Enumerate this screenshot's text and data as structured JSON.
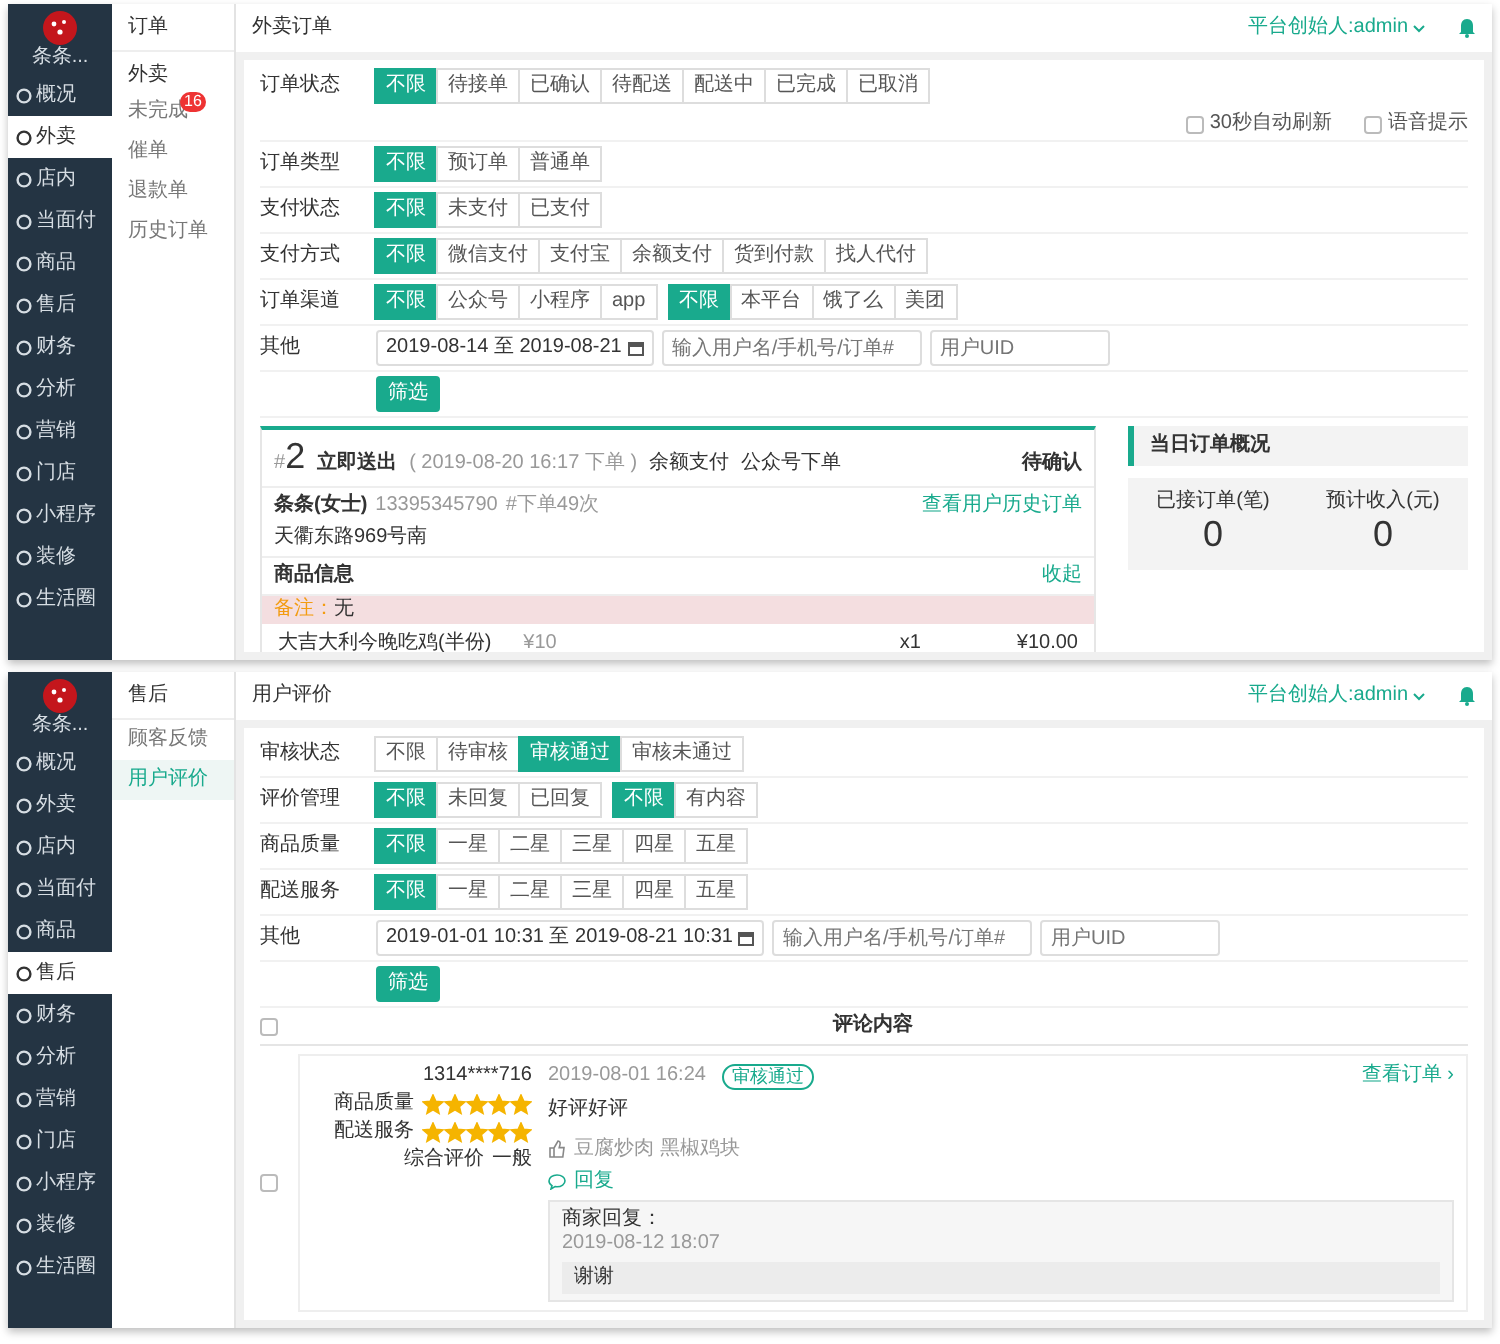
{
  "panels": [
    {
      "kind": "orders",
      "sidebar": {
        "logo": "条条...",
        "items": [
          {
            "label": "概况",
            "selected": false
          },
          {
            "label": "外卖",
            "selected": true
          },
          {
            "label": "店内",
            "selected": false
          },
          {
            "label": "当面付",
            "selected": false
          },
          {
            "label": "商品",
            "selected": false
          },
          {
            "label": "售后",
            "selected": false
          },
          {
            "label": "财务",
            "selected": false
          },
          {
            "label": "分析",
            "selected": false
          },
          {
            "label": "营销",
            "selected": false
          },
          {
            "label": "门店",
            "selected": false
          },
          {
            "label": "小程序",
            "selected": false
          },
          {
            "label": "装修",
            "selected": false
          },
          {
            "label": "生活圈",
            "selected": false
          }
        ]
      },
      "subnav": {
        "title": "订单",
        "group": "外卖",
        "items": [
          {
            "label": "未完成",
            "badge": "16",
            "selected": false
          },
          {
            "label": "催单",
            "selected": false
          },
          {
            "label": "退款单",
            "selected": false
          },
          {
            "label": "历史订单",
            "selected": false
          }
        ]
      },
      "header": {
        "title": "外卖订单",
        "user": "平台创始人:admin"
      },
      "filters": [
        {
          "kind": "buttons",
          "label": "订单状态",
          "groups": [
            [
              {
                "label": "不限",
                "selected": true
              },
              {
                "label": "待接单",
                "selected": false
              },
              {
                "label": "已确认",
                "selected": false
              },
              {
                "label": "待配送",
                "selected": false
              },
              {
                "label": "配送中",
                "selected": false
              },
              {
                "label": "已完成",
                "selected": false
              },
              {
                "label": "已取消",
                "selected": false
              }
            ]
          ],
          "options": [
            {
              "label": "30秒自动刷新",
              "checked": false
            },
            {
              "label": "语音提示",
              "checked": false
            }
          ]
        },
        {
          "kind": "buttons",
          "label": "订单类型",
          "groups": [
            [
              {
                "label": "不限",
                "selected": true
              },
              {
                "label": "预订单",
                "selected": false
              },
              {
                "label": "普通单",
                "selected": false
              }
            ]
          ]
        },
        {
          "kind": "buttons",
          "label": "支付状态",
          "groups": [
            [
              {
                "label": "不限",
                "selected": true
              },
              {
                "label": "未支付",
                "selected": false
              },
              {
                "label": "已支付",
                "selected": false
              }
            ]
          ]
        },
        {
          "kind": "buttons",
          "label": "支付方式",
          "groups": [
            [
              {
                "label": "不限",
                "selected": true
              },
              {
                "label": "微信支付",
                "selected": false
              },
              {
                "label": "支付宝",
                "selected": false
              },
              {
                "label": "余额支付",
                "selected": false
              },
              {
                "label": "货到付款",
                "selected": false
              },
              {
                "label": "找人代付",
                "selected": false
              }
            ]
          ]
        },
        {
          "kind": "buttons",
          "label": "订单渠道",
          "groups": [
            [
              {
                "label": "不限",
                "selected": true
              },
              {
                "label": "公众号",
                "selected": false
              },
              {
                "label": "小程序",
                "selected": false
              },
              {
                "label": "app",
                "selected": false
              }
            ],
            [
              {
                "label": "不限",
                "selected": true
              },
              {
                "label": "本平台",
                "selected": false
              },
              {
                "label": "饿了么",
                "selected": false
              },
              {
                "label": "美团",
                "selected": false
              }
            ]
          ]
        },
        {
          "kind": "fields",
          "label": "其他",
          "date": "2019-08-14 至 2019-08-21",
          "inputs": [
            {
              "placeholder": "输入用户名/手机号/订单#"
            },
            {
              "placeholder": "用户UID"
            }
          ]
        }
      ],
      "filter_button": "筛选",
      "order": {
        "prefix": "#",
        "number": "2",
        "dispatch": "立即送出",
        "time": "( 2019-08-20 16:17 下单 )",
        "payment": "余额支付",
        "channel": "公众号下单",
        "status": "待确认",
        "customer": "条条(女士)",
        "phone": "13395345790",
        "order_count": "#下单49次",
        "history_link": "查看用户历史订单",
        "address": "天衢东路969号南",
        "goods_title": "商品信息",
        "collapse": "收起",
        "remark_label": "备注：",
        "remark": "无",
        "items": [
          {
            "name": "大吉大利今晚吃鸡(半份)",
            "price": "¥10",
            "qty": "x1",
            "total": "¥10.00"
          }
        ]
      },
      "overview": {
        "title": "当日订单概况",
        "stats": [
          {
            "label": "已接订单(笔)",
            "value": "0"
          },
          {
            "label": "预计收入(元)",
            "value": "0"
          }
        ]
      }
    },
    {
      "kind": "reviews",
      "sidebar": {
        "logo": "条条...",
        "items": [
          {
            "label": "概况",
            "selected": false
          },
          {
            "label": "外卖",
            "selected": false
          },
          {
            "label": "店内",
            "selected": false
          },
          {
            "label": "当面付",
            "selected": false
          },
          {
            "label": "商品",
            "selected": false
          },
          {
            "label": "售后",
            "selected": true
          },
          {
            "label": "财务",
            "selected": false
          },
          {
            "label": "分析",
            "selected": false
          },
          {
            "label": "营销",
            "selected": false
          },
          {
            "label": "门店",
            "selected": false
          },
          {
            "label": "小程序",
            "selected": false
          },
          {
            "label": "装修",
            "selected": false
          },
          {
            "label": "生活圈",
            "selected": false
          }
        ]
      },
      "subnav": {
        "title": "售后",
        "items": [
          {
            "label": "顾客反馈",
            "selected": false
          },
          {
            "label": "用户评价",
            "selected": true
          }
        ]
      },
      "header": {
        "title": "用户评价",
        "user": "平台创始人:admin"
      },
      "filters": [
        {
          "kind": "buttons",
          "label": "审核状态",
          "groups": [
            [
              {
                "label": "不限",
                "selected": false
              },
              {
                "label": "待审核",
                "selected": false
              },
              {
                "label": "审核通过",
                "selected": true
              },
              {
                "label": "审核未通过",
                "selected": false
              }
            ]
          ]
        },
        {
          "kind": "buttons",
          "label": "评价管理",
          "groups": [
            [
              {
                "label": "不限",
                "selected": true
              },
              {
                "label": "未回复",
                "selected": false
              },
              {
                "label": "已回复",
                "selected": false
              }
            ],
            [
              {
                "label": "不限",
                "selected": true
              },
              {
                "label": "有内容",
                "selected": false
              }
            ]
          ]
        },
        {
          "kind": "buttons",
          "label": "商品质量",
          "groups": [
            [
              {
                "label": "不限",
                "selected": true
              },
              {
                "label": "一星",
                "selected": false
              },
              {
                "label": "二星",
                "selected": false
              },
              {
                "label": "三星",
                "selected": false
              },
              {
                "label": "四星",
                "selected": false
              },
              {
                "label": "五星",
                "selected": false
              }
            ]
          ]
        },
        {
          "kind": "buttons",
          "label": "配送服务",
          "groups": [
            [
              {
                "label": "不限",
                "selected": true
              },
              {
                "label": "一星",
                "selected": false
              },
              {
                "label": "二星",
                "selected": false
              },
              {
                "label": "三星",
                "selected": false
              },
              {
                "label": "四星",
                "selected": false
              },
              {
                "label": "五星",
                "selected": false
              }
            ]
          ]
        },
        {
          "kind": "fields",
          "label": "其他",
          "date": "2019-01-01 10:31 至 2019-08-21 10:31",
          "inputs": [
            {
              "placeholder": "输入用户名/手机号/订单#"
            },
            {
              "placeholder": "用户UID"
            }
          ]
        }
      ],
      "filter_button": "筛选",
      "reviews": {
        "select_all": false,
        "column": "评论内容",
        "rows": [
          {
            "selected": false,
            "user": "1314****716",
            "ratings": [
              {
                "label": "商品质量",
                "stars": 5
              },
              {
                "label": "配送服务",
                "stars": 5
              }
            ],
            "overall_label": "综合评价",
            "overall": "一般",
            "date": "2019-08-01 16:24",
            "status": "审核通过",
            "text": "好评好评",
            "order_link": "查看订单 ›",
            "liked": "豆腐炒肉 黑椒鸡块",
            "reply_link": "回复",
            "reply": {
              "label": "商家回复：",
              "date": "2019-08-12 18:07",
              "text": "谢谢"
            }
          }
        ]
      }
    }
  ]
}
